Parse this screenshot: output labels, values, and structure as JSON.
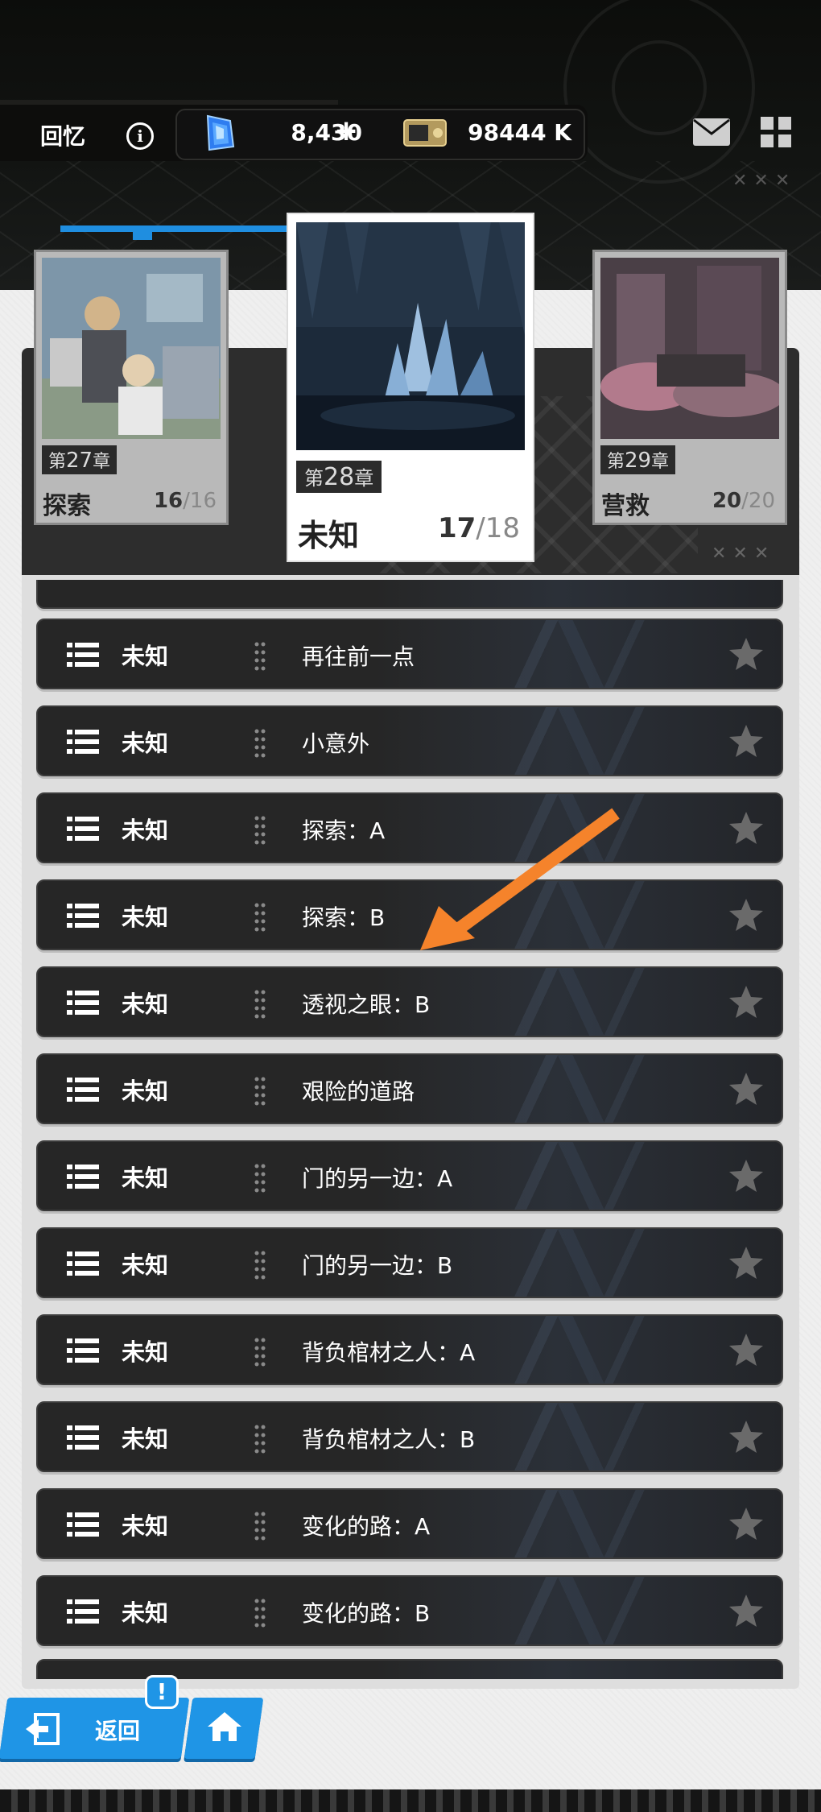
{
  "header": {
    "section_label": "回忆",
    "gems": "8,430",
    "plus_symbol": "+",
    "credits": "98444 K"
  },
  "chapters": [
    {
      "number_prefix": "第",
      "number": "27",
      "number_suffix": "章",
      "name": "探索",
      "cleared": "16",
      "total": "/16",
      "selected": false
    },
    {
      "number_prefix": "第",
      "number": "28",
      "number_suffix": "章",
      "name": "未知",
      "cleared": "17",
      "total": "/18",
      "selected": true
    },
    {
      "number_prefix": "第",
      "number": "29",
      "number_suffix": "章",
      "name": "营救",
      "cleared": "20",
      "total": "/20",
      "selected": false
    }
  ],
  "stages": [
    {
      "tag": "未知",
      "title": "再往前一点"
    },
    {
      "tag": "未知",
      "title": "小意外"
    },
    {
      "tag": "未知",
      "title": "探索：A"
    },
    {
      "tag": "未知",
      "title": "探索：B"
    },
    {
      "tag": "未知",
      "title": "透视之眼：B"
    },
    {
      "tag": "未知",
      "title": "艰险的道路"
    },
    {
      "tag": "未知",
      "title": "门的另一边：A"
    },
    {
      "tag": "未知",
      "title": "门的另一边：B"
    },
    {
      "tag": "未知",
      "title": "背负棺材之人：A"
    },
    {
      "tag": "未知",
      "title": "背负棺材之人：B"
    },
    {
      "tag": "未知",
      "title": "变化的路：A"
    },
    {
      "tag": "未知",
      "title": "变化的路：B"
    }
  ],
  "footer": {
    "back_label": "返回",
    "alert_symbol": "!"
  },
  "colors": {
    "accent_blue": "#1f95e6",
    "annotation_arrow": "#f5832b"
  }
}
